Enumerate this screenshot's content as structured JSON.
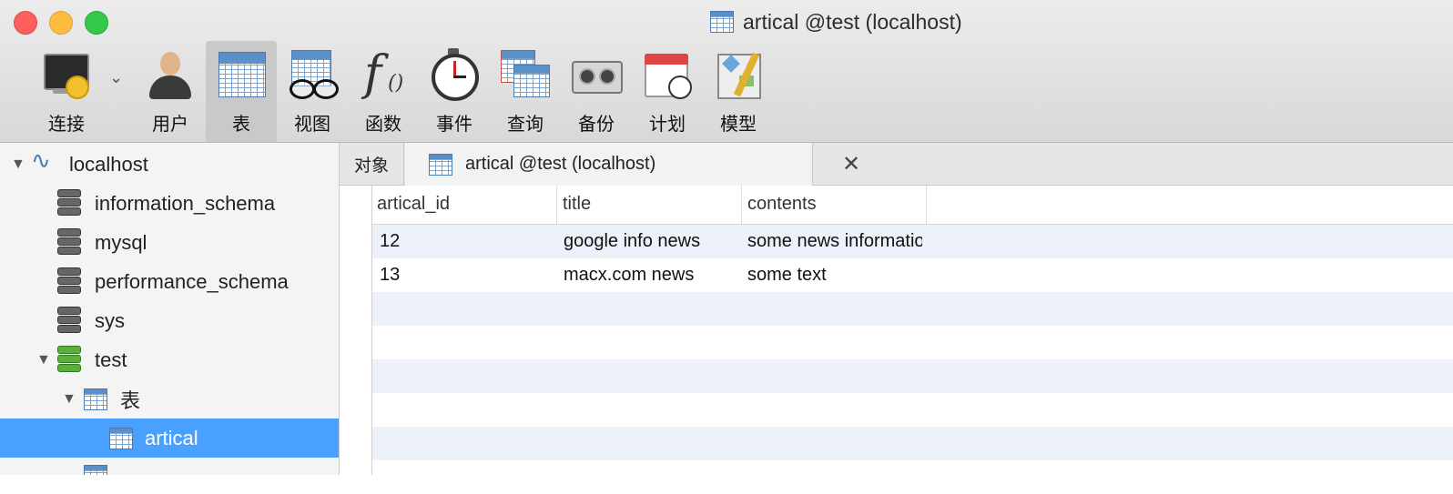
{
  "window": {
    "title": "artical @test (localhost)"
  },
  "toolbar": {
    "connect": "连接",
    "user": "用户",
    "table": "表",
    "view": "视图",
    "function": "函数",
    "event": "事件",
    "query": "查询",
    "backup": "备份",
    "schedule": "计划",
    "model": "模型"
  },
  "sidebar": {
    "host": "localhost",
    "databases": [
      "information_schema",
      "mysql",
      "performance_schema",
      "sys",
      "test"
    ],
    "tables_folder": "表",
    "selected_table": "artical"
  },
  "tabs": {
    "objects": "对象",
    "open_tab": "artical @test (localhost)"
  },
  "grid": {
    "columns": [
      "artical_id",
      "title",
      "contents"
    ],
    "rows": [
      [
        "12",
        "google info news",
        "some news information"
      ],
      [
        "13",
        "macx.com news",
        "some text"
      ]
    ]
  }
}
